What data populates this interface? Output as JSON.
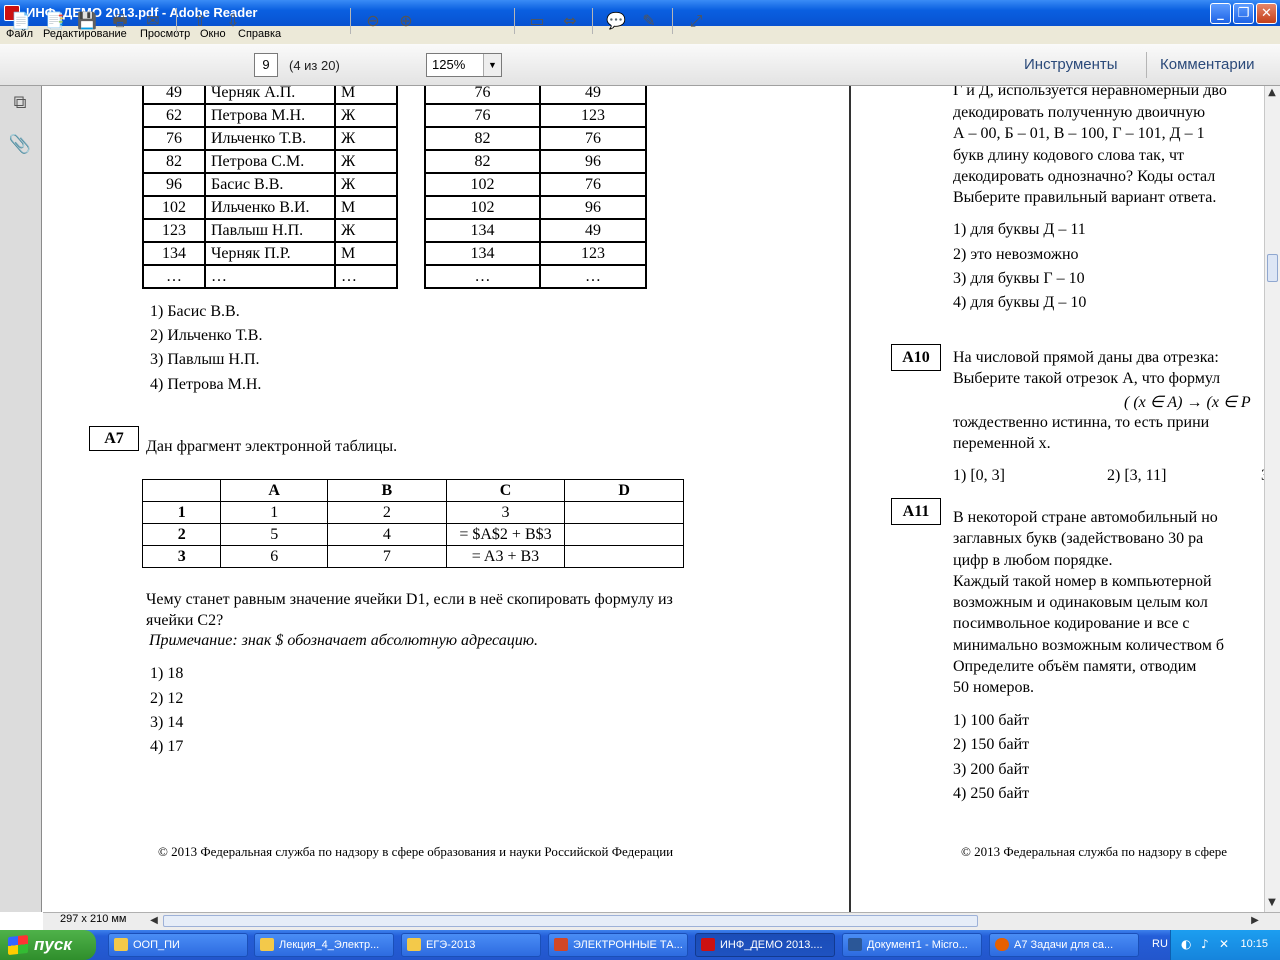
{
  "window": {
    "title": "ИНФ_ДЕМО 2013.pdf - Adobe Reader",
    "min": "_",
    "max": "❐",
    "close": "✕"
  },
  "menu": [
    "Файл",
    "Редактирование",
    "Просмотр",
    "Окно",
    "Справка"
  ],
  "toolbar": {
    "page": "9",
    "page_count": "(4 из 20)",
    "zoom": "125%",
    "tools": "Инструменты",
    "comments": "Комментарии"
  },
  "left": {
    "rows": [
      {
        "id": "49",
        "name": "Черняк А.П.",
        "sex": "М",
        "a": "76",
        "b": "49"
      },
      {
        "id": "62",
        "name": "Петрова М.Н.",
        "sex": "Ж",
        "a": "76",
        "b": "123"
      },
      {
        "id": "76",
        "name": "Ильченко Т.В.",
        "sex": "Ж",
        "a": "82",
        "b": "76"
      },
      {
        "id": "82",
        "name": "Петрова С.М.",
        "sex": "Ж",
        "a": "82",
        "b": "96"
      },
      {
        "id": "96",
        "name": "Басис В.В.",
        "sex": "Ж",
        "a": "102",
        "b": "76"
      },
      {
        "id": "102",
        "name": "Ильченко В.И.",
        "sex": "М",
        "a": "102",
        "b": "96"
      },
      {
        "id": "123",
        "name": "Павлыш Н.П.",
        "sex": "Ж",
        "a": "134",
        "b": "49"
      },
      {
        "id": "134",
        "name": "Черняк П.Р.",
        "sex": "М",
        "a": "134",
        "b": "123"
      },
      {
        "id": "…",
        "name": "…",
        "sex": "…",
        "a": "…",
        "b": "…"
      }
    ],
    "a6_options": [
      "1)  Басис В.В.",
      "2)  Ильченко Т.В.",
      "3)  Павлыш Н.П.",
      "4)  Петрова М.Н."
    ],
    "a7_label": "А7",
    "a7_intro": "Дан фрагмент электронной таблицы.",
    "sheet": {
      "headers": [
        "",
        "A",
        "B",
        "C",
        "D"
      ],
      "rows": [
        [
          "1",
          "1",
          "2",
          "3",
          ""
        ],
        [
          "2",
          "5",
          "4",
          "= $A$2 + B$3",
          ""
        ],
        [
          "3",
          "6",
          "7",
          "= A3 + B3",
          ""
        ]
      ]
    },
    "a7_q1": "Чему станет равным значение ячейки D1, если в неё скопировать формулу из",
    "a7_q2": "ячейки  C2?",
    "a7_note": "Примечание: знак $ обозначает абсолютную адресацию.",
    "a7_options": [
      "1)  18",
      "2)  12",
      "3)  14",
      "4)  17"
    ],
    "footer": "© 2013 Федеральная служба по надзору в сфере образования и науки Российской Федерации"
  },
  "right": {
    "top_lines": [
      "Г и Д, используется неравномерный дво",
      "декодировать полученную двоичную",
      "А – 00, Б – 01, В – 100, Г – 101, Д – 1",
      "букв длину кодового слова так, чт",
      "декодировать однозначно? Коды остал",
      "Выберите правильный вариант ответа."
    ],
    "a9_options": [
      "1)  для буквы Д – 11",
      "2)  это невозможно",
      "3)  для буквы Г – 10",
      "4)  для буквы Д – 10"
    ],
    "a10_label": "А10",
    "a10_lines": [
      "На числовой прямой даны два отрезка:",
      "Выберите такой отрезок А, что формул"
    ],
    "a10_formula": "( (x ∈ A) →  (x ∈ P",
    "a10_lines2": [
      "тождественно истинна, то есть прини",
      "переменной x."
    ],
    "a10_opt1": "1)  [0, 3]",
    "a10_opt2": "2)  [3, 11]",
    "a10_opt3": "3",
    "a11_label": "А11",
    "a11_lines": [
      "В некоторой стране автомобильный но",
      "заглавных букв (задействовано 30 ра",
      "цифр в любом порядке.",
      "Каждый такой номер в компьютерной",
      "возможным и одинаковым целым кол",
      "посимвольное кодирование и все с",
      "минимально возможным количеством б",
      "Определите объём памяти, отводим",
      "50 номеров."
    ],
    "a11_options": [
      "1)  100 байт",
      "2)  150 байт",
      "3)  200 байт",
      "4)  250 байт"
    ],
    "footer": "© 2013 Федеральная служба по надзору в сфере"
  },
  "status": {
    "page_size": "297 x 210 мм"
  },
  "taskbar": {
    "start": "пуск",
    "tasks": [
      "ООП_ПИ",
      "Лекция_4_Электр...",
      "ЕГЭ-2013",
      "ЭЛЕКТРОННЫЕ ТА...",
      "ИНФ_ДЕМО 2013....",
      "Документ1 - Micro...",
      "А7 Задачи для са..."
    ],
    "lang": "RU",
    "clock": "10:15"
  }
}
